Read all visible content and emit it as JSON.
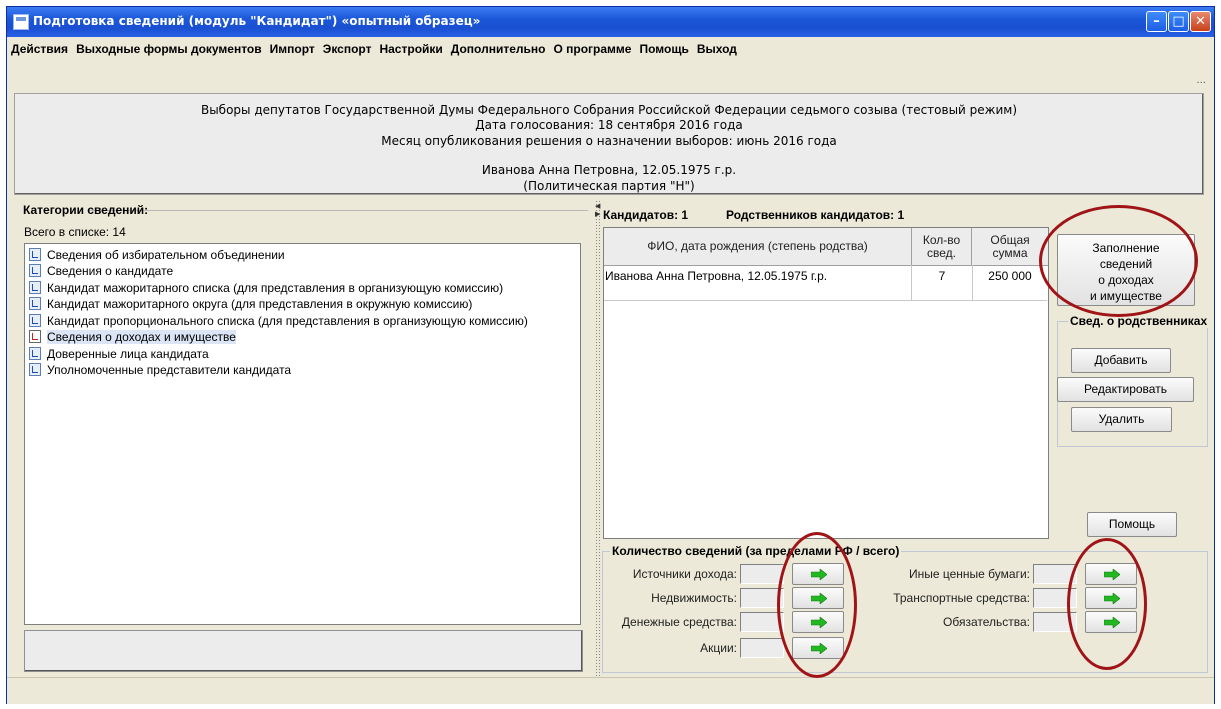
{
  "window": {
    "title": "Подготовка сведений (модуль \"Кандидат\") «опытный образец»"
  },
  "menu": {
    "items": [
      "Действия",
      "Выходные формы документов",
      "Импорт",
      "Экспорт",
      "Настройки",
      "Дополнительно",
      "О программе",
      "Помощь",
      "Выход"
    ]
  },
  "toolbar": {
    "overflow": "..."
  },
  "header": {
    "line1": "Выборы депутатов Государственной Думы Федерального Собрания Российской Федерации седьмого созыва (тестовый режим)",
    "line2": "Дата голосования: 18 сентября 2016 года",
    "line3": "Месяц опубликования решения о назначении выборов: июнь 2016 года",
    "line4": "Иванова Анна Петровна, 12.05.1975 г.р.",
    "line5": "(Политическая партия \"Н\")"
  },
  "categories": {
    "title": "Категории сведений:",
    "count_label": "Всего в списке: 14",
    "items": [
      {
        "label": "Сведения об избирательном объединении",
        "selected": false
      },
      {
        "label": "Сведения о кандидате",
        "selected": false
      },
      {
        "label": "Кандидат мажоритарного списка (для представления в организующую комиссию)",
        "selected": false
      },
      {
        "label": "Кандидат мажоритарного округа (для представления в окружную комиссию)",
        "selected": false
      },
      {
        "label": "Кандидат пропорционального списка (для представления в организующую комиссию)",
        "selected": false
      },
      {
        "label": "Сведения о доходах и имуществе",
        "selected": true
      },
      {
        "label": "Доверенные лица кандидата",
        "selected": false
      },
      {
        "label": "Уполномоченные представители кандидата",
        "selected": false
      }
    ]
  },
  "candidates": {
    "count_label": "Кандидатов: 1",
    "relatives_label": "Родственников кандидатов: 1",
    "columns": [
      "ФИО, дата рождения (степень родства)",
      "Кол-во свед.",
      "Общая сумма"
    ],
    "rows": [
      {
        "name": "Иванова Анна Петровна, 12.05.1975 г.р.",
        "count": "7",
        "sum": "250 000"
      }
    ]
  },
  "actions": {
    "fill_button": [
      "Заполнение",
      "сведений",
      "о доходах",
      "и имуществе"
    ],
    "relatives_group_title": "Свед. о родственниках",
    "add": "Добавить",
    "edit": "Редактировать",
    "delete": "Удалить",
    "help": "Помощь"
  },
  "quantity": {
    "title": "Количество сведений (за пределами РФ / всего)",
    "left": [
      {
        "label": "Источники дохода:",
        "value": ""
      },
      {
        "label": "Недвижимость:",
        "value": ""
      },
      {
        "label": "Денежные средства:",
        "value": ""
      },
      {
        "label": "Акции:",
        "value": ""
      }
    ],
    "right": [
      {
        "label": "Иные ценные бумаги:",
        "value": ""
      },
      {
        "label": "Транспортные средства:",
        "value": ""
      },
      {
        "label": "Обязательства:",
        "value": ""
      }
    ]
  },
  "colors": {
    "titlebar": "#1b57d8",
    "window_bg": "#ece9d8",
    "highlight_ring": "#a01418",
    "arrow": "#22b822",
    "selection": "#dbe5f5"
  },
  "icons": {
    "app": "app-window-icon",
    "list_item": "document-icon",
    "arrow": "green-arrow-right-icon"
  }
}
